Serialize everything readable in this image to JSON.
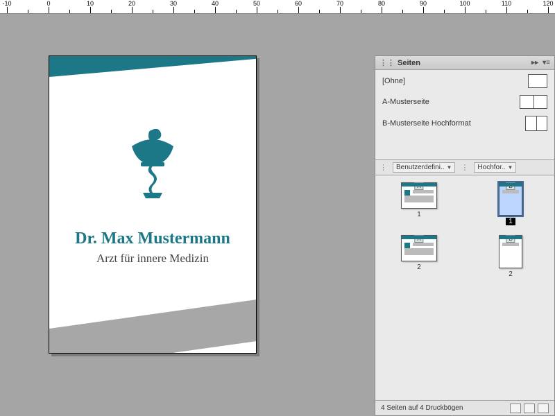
{
  "ruler": {
    "start": -10,
    "step": 10,
    "count": 14
  },
  "document": {
    "title": "Dr. Max Mustermann",
    "subtitle": "Arzt für innere Medizin",
    "accent_color": "#1c7886"
  },
  "panel": {
    "title": "Seiten",
    "masters": [
      {
        "label": "[Ohne]",
        "kind": "single"
      },
      {
        "label": "A-Musterseite",
        "kind": "double"
      },
      {
        "label": "B-Musterseite Hochformat",
        "kind": "portrait-pair"
      }
    ],
    "sections": [
      {
        "label": "Benutzerdefini.."
      },
      {
        "label": "Hochfor.."
      }
    ],
    "pages": [
      {
        "tag": "A",
        "num": "1",
        "orientation": "landscape",
        "selected": false,
        "num_inverted": false,
        "layout": "detail"
      },
      {
        "tag": "B",
        "num": "1",
        "orientation": "portrait",
        "selected": true,
        "num_inverted": true,
        "layout": "simple"
      },
      {
        "tag": "A",
        "num": "2",
        "orientation": "landscape",
        "selected": false,
        "num_inverted": false,
        "layout": "detail"
      },
      {
        "tag": "B",
        "num": "2",
        "orientation": "portrait",
        "selected": false,
        "num_inverted": false,
        "layout": "simple"
      }
    ],
    "footer": "4 Seiten auf 4 Druckbögen"
  }
}
